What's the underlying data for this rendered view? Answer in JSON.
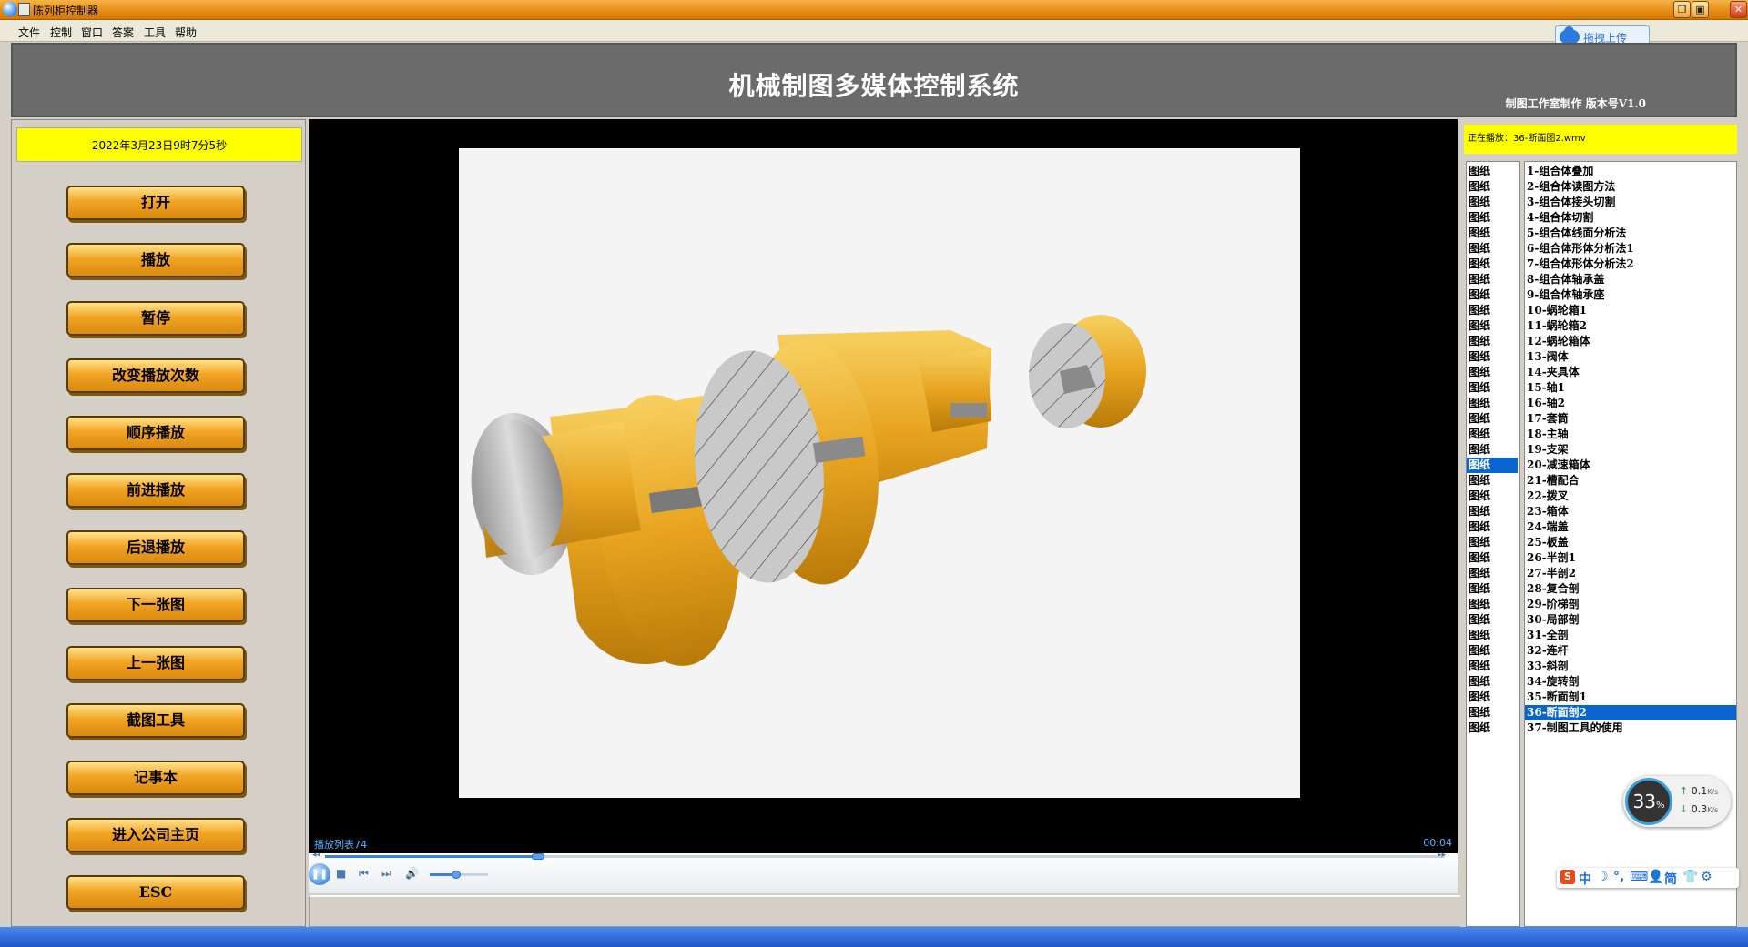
{
  "window": {
    "title": "陈列柜控制器"
  },
  "menu": [
    "文件",
    "控制",
    "窗口",
    "答案",
    "工具",
    "帮助"
  ],
  "upload": {
    "label": "拖拽上传"
  },
  "header": {
    "title": "机械制图多媒体控制系统",
    "subtitle": "制图工作室制作  版本号V1.0"
  },
  "left": {
    "datetime": "2022年3月23日9时7分5秒",
    "buttons": [
      "打开",
      "播放",
      "暂停",
      "改变播放次数",
      "顺序播放",
      "前进播放",
      "后退播放",
      "下一张图",
      "上一张图",
      "截图工具",
      "记事本",
      "进入公司主页",
      "ESC"
    ]
  },
  "player": {
    "playlist_label": "播放列表74",
    "time": "00:04",
    "progress": 0.19,
    "volume": 0.45,
    "icons": {
      "play_pause": "pause-icon",
      "stop": "stop-icon",
      "prev": "prev-icon",
      "next": "next-icon",
      "volume": "speaker-icon"
    }
  },
  "right": {
    "now_playing": "正在播放：36-断面图2.wmv",
    "category": "图纸",
    "selected_left_index": 19,
    "selected_right_index": 35,
    "items": [
      "1-组合体叠加",
      "2-组合体读图方法",
      "3-组合体接头切割",
      "4-组合体切割",
      "5-组合体线面分析法",
      "6-组合体形体分析法1",
      "7-组合体形体分析法2",
      "8-组合体轴承盖",
      "9-组合体轴承座",
      "10-蜗轮箱1",
      "11-蜗轮箱2",
      "12-蜗轮箱体",
      "13-阀体",
      "14-夹具体",
      "15-轴1",
      "16-轴2",
      "17-套筒",
      "18-主轴",
      "19-支架",
      "20-减速箱体",
      "21-槽配合",
      "22-拨叉",
      "23-箱体",
      "24-端盖",
      "25-板盖",
      "26-半剖1",
      "27-半剖2",
      "28-复合剖",
      "29-阶梯剖",
      "30-局部剖",
      "31-全剖",
      "32-连杆",
      "33-斜剖",
      "34-旋转剖",
      "35-断面剖1",
      "36-断面剖2",
      "37-制图工具的使用"
    ]
  },
  "system": {
    "cpu": "33",
    "cpu_unit": "%",
    "up": "0.1",
    "down": "0.3",
    "speed_unit": "K/s",
    "ime": [
      "中",
      "简"
    ]
  },
  "colors": {
    "accent_yellow": "#ffff00",
    "button_orange": "#f2a424",
    "selection_blue": "#0a64d0",
    "header_gray": "#6b6b6b"
  }
}
